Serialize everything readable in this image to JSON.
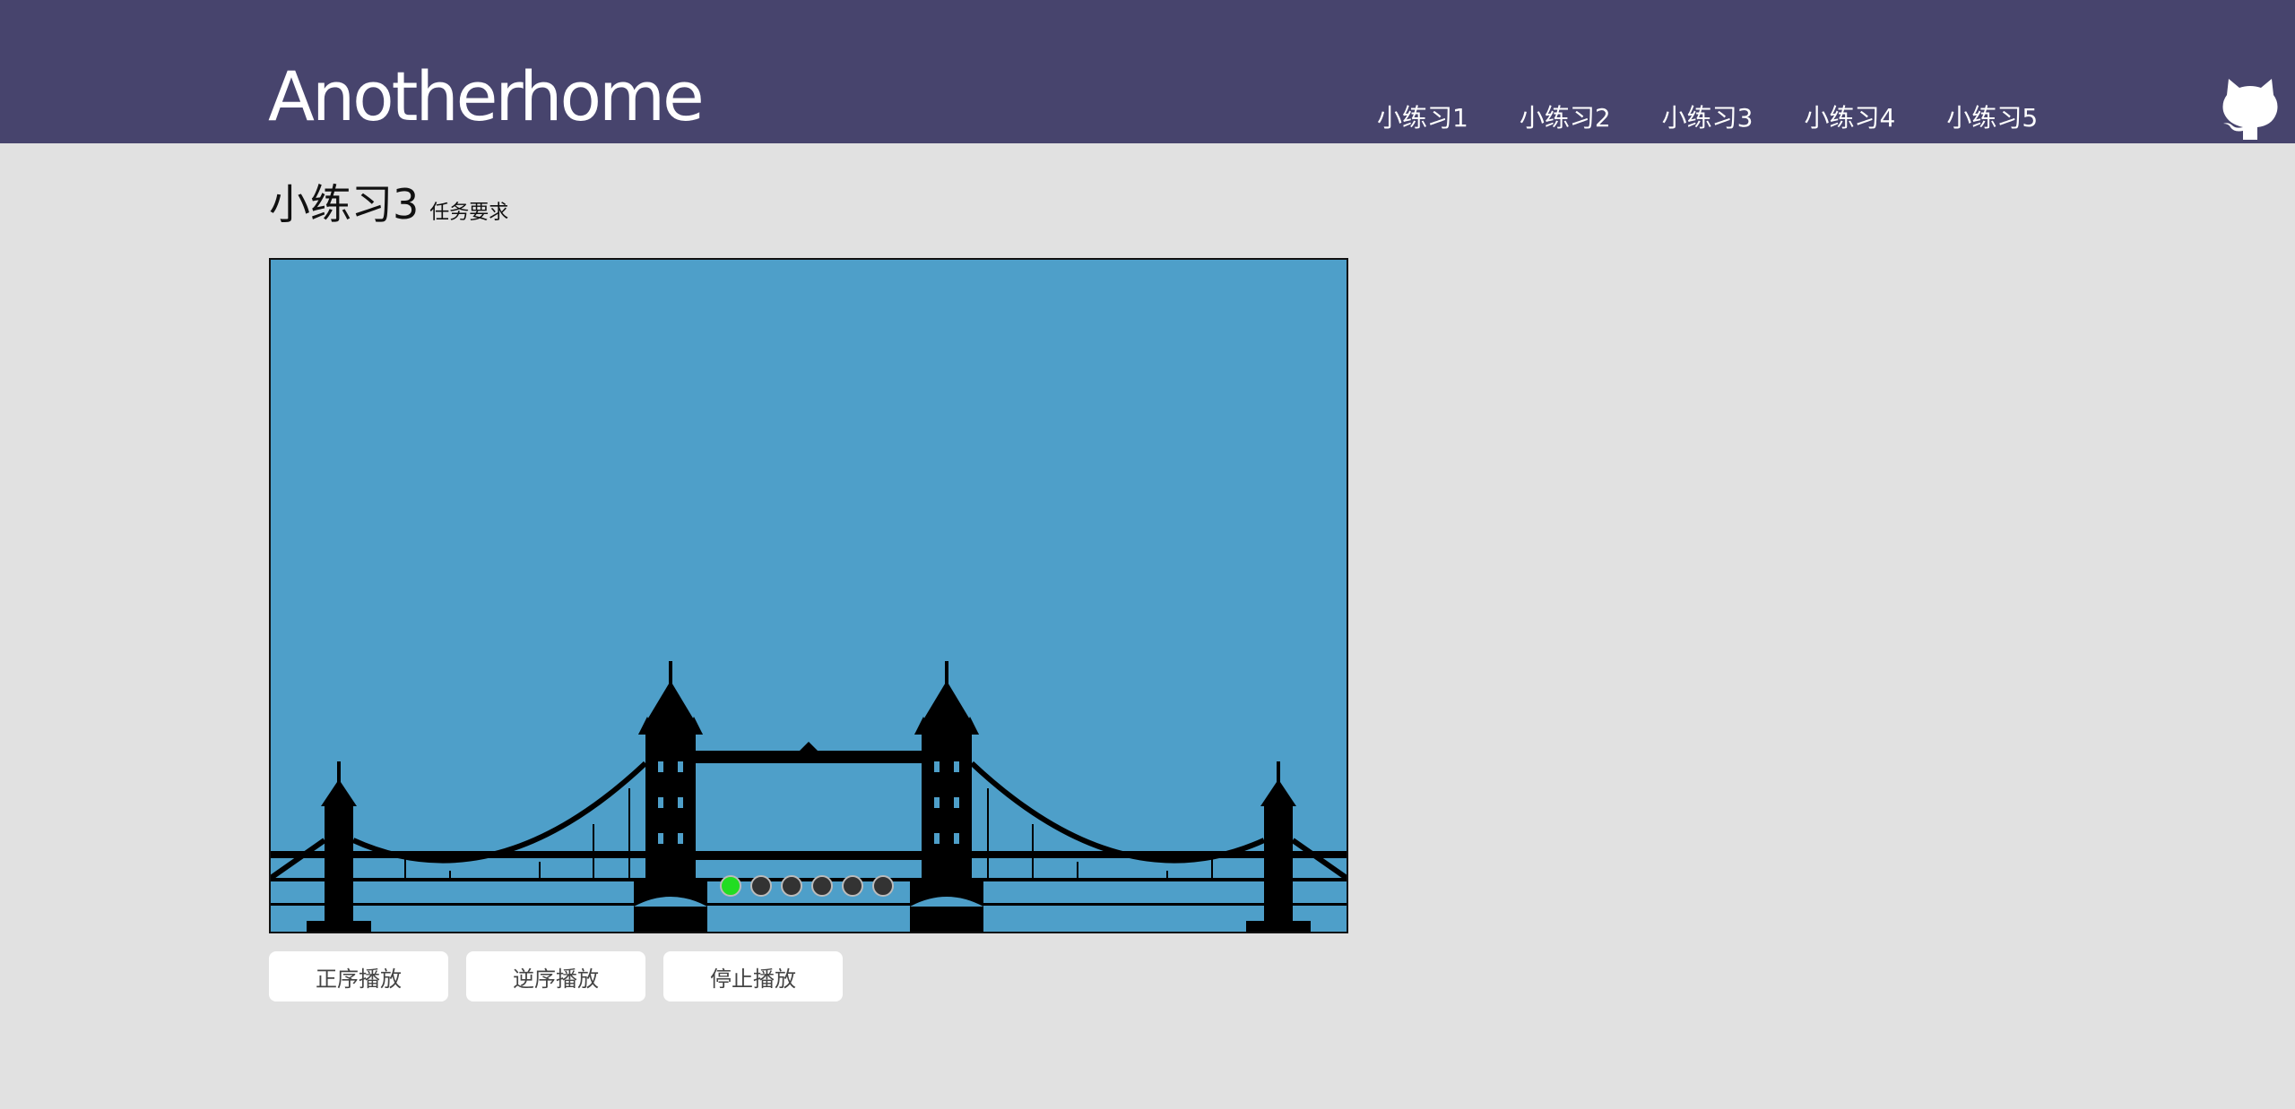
{
  "brand": "Anotherhome",
  "nav": {
    "items": [
      {
        "label": "小练习1"
      },
      {
        "label": "小练习2"
      },
      {
        "label": "小练习3"
      },
      {
        "label": "小练习4"
      },
      {
        "label": "小练习5"
      }
    ]
  },
  "github_icon": "github-octocat-icon",
  "page": {
    "title": "小练习3",
    "subtitle": "任务要求"
  },
  "slider": {
    "image_subject": "Tower Bridge silhouette",
    "background_color": "#4e9fc9",
    "dot_count": 6,
    "active_dot": 1,
    "active_color": "#22dd22",
    "inactive_color": "#333333"
  },
  "controls": {
    "forward_label": "正序播放",
    "reverse_label": "逆序播放",
    "stop_label": "停止播放"
  },
  "colors": {
    "header_bg": "#47446d",
    "page_bg": "#e1e1e1"
  }
}
